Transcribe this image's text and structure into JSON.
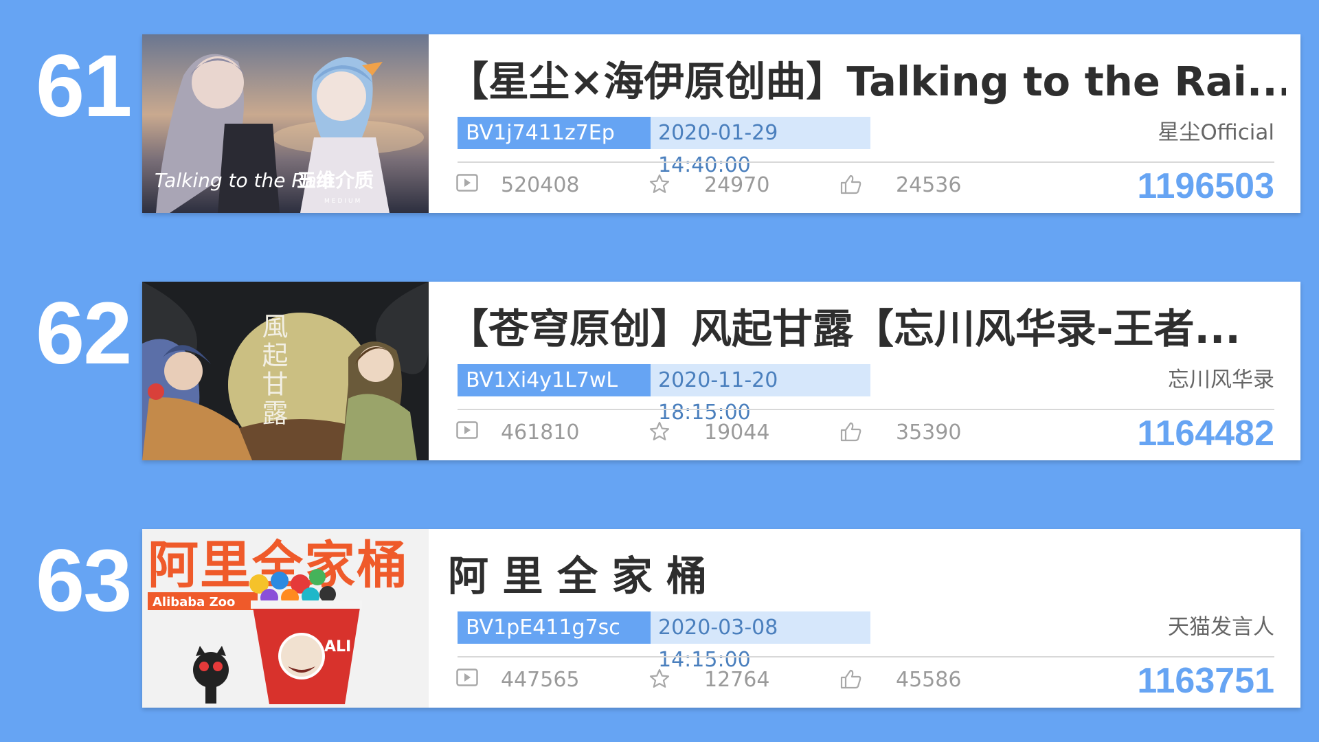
{
  "entries": [
    {
      "rank": "61",
      "title": "【星尘×海伊原创曲】Talking to the Rai...",
      "bvid": "BV1j7411z7Ep",
      "date": "2020-01-29 14:40:00",
      "uploader": "星尘Official",
      "views": "520408",
      "favorites": "24970",
      "likes": "24536",
      "score": "1196503",
      "thumb_text": [
        "Talking to the Rain",
        "五维介质",
        "MEDIUM"
      ]
    },
    {
      "rank": "62",
      "title": "【苍穹原创】风起甘露【忘川风华录-王者...",
      "bvid": "BV1Xi4y1L7wL",
      "date": "2020-11-20 18:15:00",
      "uploader": "忘川风华录",
      "views": "461810",
      "favorites": "19044",
      "likes": "35390",
      "score": "1164482",
      "thumb_text": [
        "風起甘露"
      ]
    },
    {
      "rank": "63",
      "title": "阿 里 全 家 桶",
      "bvid": "BV1pE411g7sc",
      "date": "2020-03-08 14:15:00",
      "uploader": "天猫发言人",
      "views": "447565",
      "favorites": "12764",
      "likes": "45586",
      "score": "1163751",
      "thumb_text": [
        "阿里全家桶",
        "Alibaba Zoo",
        "ALI"
      ]
    }
  ],
  "icons": {
    "views": "play-icon",
    "favorites": "star-icon",
    "likes": "thumbs-up-icon"
  },
  "colors": {
    "background": "#66a4f3",
    "accent": "#66a4f3",
    "date_bg": "#d6e7fb",
    "title": "#2e2e2e"
  }
}
